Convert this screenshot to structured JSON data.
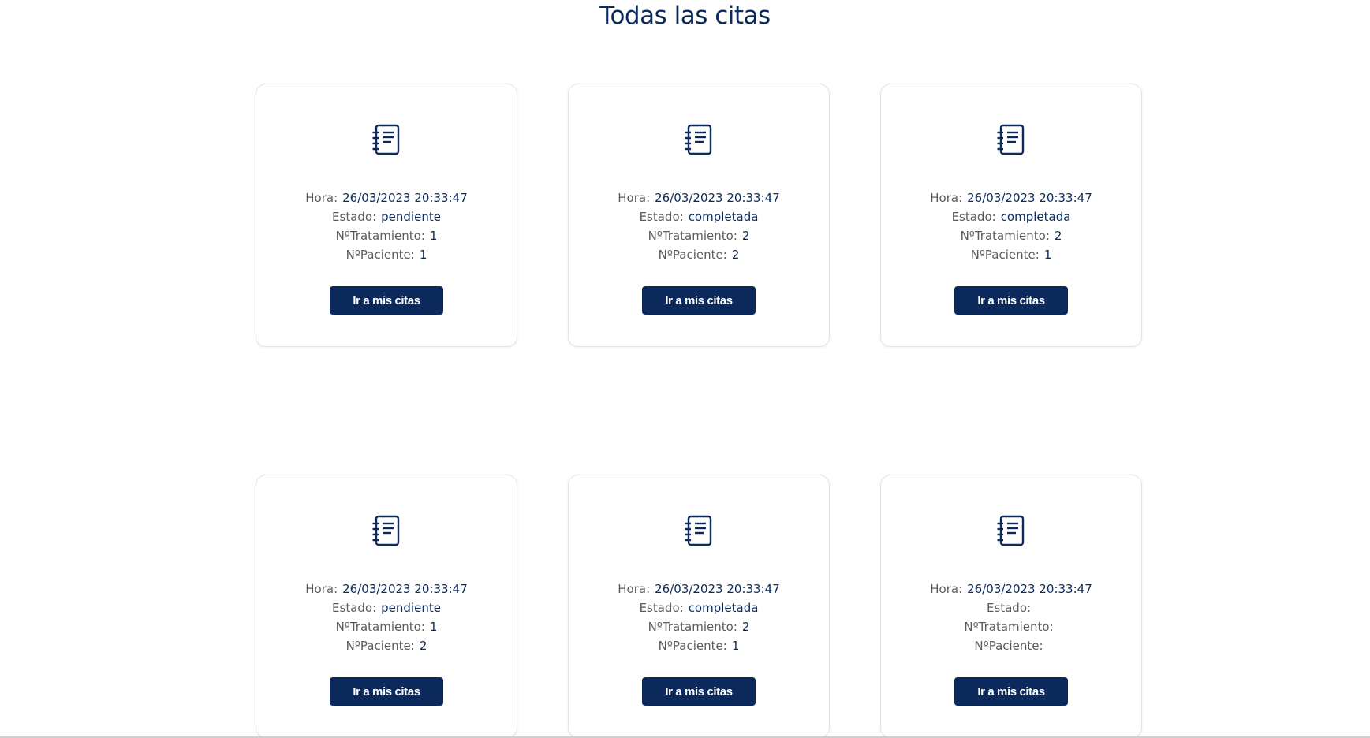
{
  "page": {
    "title": "Todas las citas"
  },
  "colors": {
    "primary": "#0b2a5b",
    "label": "#5b5b5b",
    "card_border": "#e4e4e4"
  },
  "labels": {
    "hora": "Hora:",
    "estado": "Estado:",
    "tratamiento": "NºTratamiento:",
    "paciente": "NºPaciente:"
  },
  "cards": [
    {
      "icon": "notebook-icon",
      "hora": "26/03/2023 20:33:47",
      "estado": "pendiente",
      "tratamiento": "1",
      "paciente": "1",
      "button": "Ir a mis citas"
    },
    {
      "icon": "notebook-icon",
      "hora": "26/03/2023 20:33:47",
      "estado": "completada",
      "tratamiento": "2",
      "paciente": "2",
      "button": "Ir a mis citas"
    },
    {
      "icon": "notebook-icon",
      "hora": "26/03/2023 20:33:47",
      "estado": "completada",
      "tratamiento": "2",
      "paciente": "1",
      "button": "Ir a mis citas"
    },
    {
      "icon": "notebook-icon",
      "hora": "26/03/2023 20:33:47",
      "estado": "pendiente",
      "tratamiento": "1",
      "paciente": "2",
      "button": "Ir a mis citas"
    },
    {
      "icon": "notebook-icon",
      "hora": "26/03/2023 20:33:47",
      "estado": "completada",
      "tratamiento": "2",
      "paciente": "1",
      "button": "Ir a mis citas"
    },
    {
      "icon": "notebook-icon",
      "hora": "26/03/2023 20:33:47",
      "estado": "",
      "tratamiento": "",
      "paciente": "",
      "button": "Ir a mis citas"
    }
  ]
}
